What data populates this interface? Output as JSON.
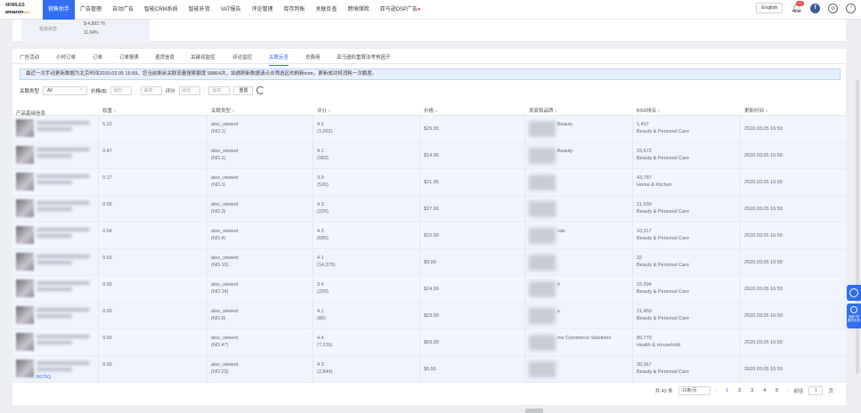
{
  "logo": {
    "line1": "4KMILES",
    "line2": "amazon",
    "line2_suffix": "spn"
  },
  "nav": {
    "items": [
      "销售助手",
      "广告管理",
      "自动广告",
      "智能CRM系统",
      "智能补货",
      "VAT报告",
      "评论管理",
      "库存判账",
      "关联反查",
      "跨境保险",
      "亚马逊DSP广告"
    ],
    "active_index": 0,
    "hot_mark": "●"
  },
  "header_right": {
    "lang": "English",
    "notif_count": "41"
  },
  "summary": {
    "label": "投放状态",
    "value1": "$-4,893.76",
    "value2": "11.04%"
  },
  "tabs": [
    "广告活动",
    "小时订单",
    "订单",
    "订单报表",
    "退货信息",
    "关键词监控",
    "评论监控",
    "关联反查",
    "总费用",
    "亚马逊权重算法考核因子"
  ],
  "active_tab": 7,
  "notice": {
    "text": "最近一次手动更新数据为北京时间2020.03.05 16:59。您当前剩余关联流量搜索额度 99864次，如遇刷新数据请点击筛选区的刷新icon，更新成功将消耗一次额度。",
    "link": ""
  },
  "filters": {
    "type_label": "关联类型",
    "type_value": "All",
    "price_label": "价格($)",
    "min_placeholder": "最低",
    "max_placeholder": "最高",
    "rating_label": "评分",
    "rmin_placeholder": "最低",
    "rmax_placeholder": "最高",
    "reset_label": "重置"
  },
  "table": {
    "headers": [
      "产品基础信息",
      "权重",
      "关联类型",
      "评分",
      "价格",
      "卖家和品牌",
      "BSR排名",
      "更新时间"
    ],
    "rows": [
      {
        "weight": "5.23",
        "type": "also_viewed",
        "no": "(NO.1)",
        "rating": "4.5",
        "reviews": "(1,062)",
        "price": "$29.95",
        "seller": "Beauty",
        "bsr": "1,407",
        "category": "Beauty & Personal Care",
        "time": "2020.03.05 16:59"
      },
      {
        "weight": "0.47",
        "type": "also_viewed",
        "no": "(NO.1)",
        "rating": "4.1",
        "reviews": "(983)",
        "price": "$14.95",
        "seller": "Beauty",
        "bsr": "15,672",
        "category": "Beauty & Personal Care",
        "time": "2020.03.05 16:59"
      },
      {
        "weight": "0.17",
        "type": "also_viewed",
        "no": "(NO.1)",
        "rating": "3.9",
        "reviews": "(526)",
        "price": "$21.95",
        "seller": "",
        "bsr": "43,787",
        "category": "Home & Kitchen",
        "time": "2020.03.05 16:59"
      },
      {
        "weight": "0.05",
        "type": "also_viewed",
        "no": "(NO.3)",
        "rating": "4.3",
        "reviews": "(226)",
        "price": "$27.99",
        "seller": "",
        "bsr": "21,639",
        "category": "Beauty & Personal Care",
        "time": "2020.03.05 16:59"
      },
      {
        "weight": "0.04",
        "type": "also_viewed",
        "no": "(NO.4)",
        "rating": "4.3",
        "reviews": "(685)",
        "price": "$15.99",
        "seller": "rals",
        "bsr": "10,317",
        "category": "Beauty & Personal Care",
        "time": "2020.03.05 16:59"
      },
      {
        "weight": "0.03",
        "type": "also_viewed",
        "no": "(NO.10)",
        "rating": "4.1",
        "reviews": "(14,375)",
        "price": "$9.99",
        "seller": "",
        "bsr": "32",
        "category": "Beauty & Personal Care",
        "time": "2020.03.05 16:59"
      },
      {
        "weight": "0.00",
        "type": "also_viewed",
        "no": "(NO.14)",
        "rating": "3.4",
        "reviews": "(220)",
        "price": "$24.99",
        "seller": "h",
        "bsr": "15,994",
        "category": "Beauty & Personal Care",
        "time": "2020.03.05 16:59"
      },
      {
        "weight": "0.00",
        "type": "also_viewed",
        "no": "(NO.6)",
        "rating": "4.1",
        "reviews": "(86)",
        "price": "$23.99",
        "seller": "s",
        "bsr": "21,460",
        "category": "Beauty & Personal Care",
        "time": "2020.03.05 16:59"
      },
      {
        "weight": "0.00",
        "type": "also_viewed",
        "no": "(NO.47)",
        "rating": "4.4",
        "reviews": "(7,226)",
        "price": "$69.99",
        "seller": "me Commerce Solutions",
        "bsr": "89,779",
        "category": "Health & Household",
        "time": "2020.03.05 16:59"
      },
      {
        "weight": "0.00",
        "type": "also_viewed",
        "no": "(NO.23)",
        "rating": "4.3",
        "reviews": "(2,844)",
        "price": "$6.95",
        "seller": "",
        "bsr": "20,367",
        "category": "Beauty & Personal Care",
        "time": "2020.03.05 16:59",
        "asin_prefix": "B07SQ"
      }
    ]
  },
  "pagination": {
    "total": "共 43 条",
    "per_page": "10条/页",
    "pages": [
      "1",
      "2",
      "3",
      "4",
      "5"
    ],
    "active": "1",
    "goto_label": "前往",
    "goto_value": "1",
    "goto_suffix": "页"
  },
  "side": {
    "widget2": "领取7折 服务优惠"
  }
}
